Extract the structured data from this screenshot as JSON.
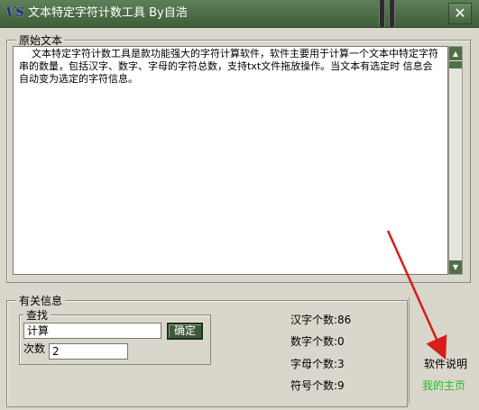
{
  "window": {
    "icon_text": "VS",
    "title": "文本特定字符计数工具 By自浩",
    "close_glyph": "✕"
  },
  "source_group": {
    "legend": "原始文本",
    "text": "    文本特定字符计数工具是款功能强大的字符计算软件，软件主要用于计算一个文本中特定字符串的数量，包括汉字、数字、字母的字符总数，支持txt文件拖放操作。当文本有选定时 信息会自动变为选定的字符信息。"
  },
  "info_group": {
    "legend": "有关信息",
    "search": {
      "legend": "查找",
      "input_value": "计算",
      "confirm_label": "确定",
      "count_label": "次数",
      "count_value": "2"
    },
    "stats": [
      {
        "label": "汉字个数:",
        "value": "86"
      },
      {
        "label": "数字个数:",
        "value": "0"
      },
      {
        "label": "字母个数:",
        "value": "3"
      },
      {
        "label": "符号个数:",
        "value": "9"
      }
    ]
  },
  "links": {
    "help": "软件说明",
    "home": "我的主页"
  },
  "colors": {
    "titlebar": "#4b6b46",
    "button": "#3e5a3a",
    "home_link": "#22c122",
    "annotation_arrow": "#d91c1c"
  }
}
